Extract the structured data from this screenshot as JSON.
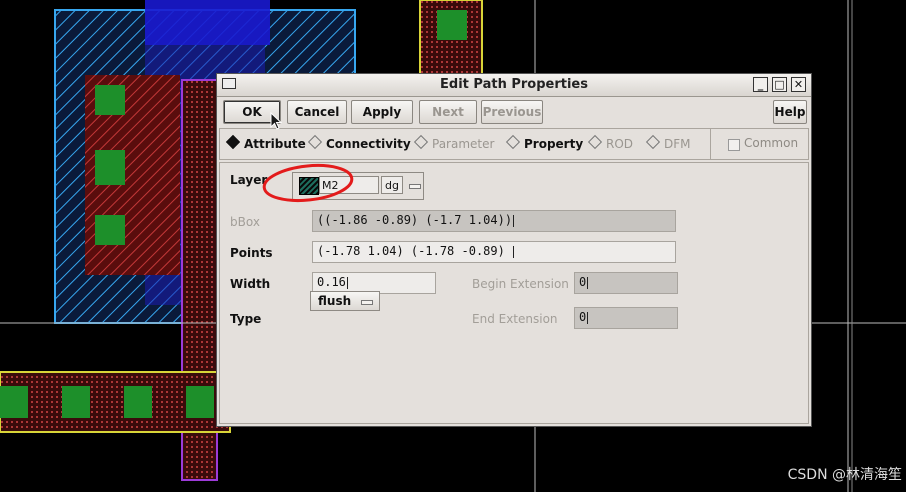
{
  "dialog": {
    "title": "Edit Path Properties",
    "window_buttons": {
      "minimize": "_",
      "maximize": "□",
      "close": "✕"
    },
    "toolbar": {
      "ok": "OK",
      "cancel": "Cancel",
      "apply": "Apply",
      "next": "Next",
      "previous": "Previous",
      "help": "Help"
    },
    "tabs": [
      {
        "label": "Attribute",
        "selected": true,
        "enabled": true
      },
      {
        "label": "Connectivity",
        "selected": false,
        "enabled": true
      },
      {
        "label": "Parameter",
        "selected": false,
        "enabled": false
      },
      {
        "label": "Property",
        "selected": false,
        "enabled": true
      },
      {
        "label": "ROD",
        "selected": false,
        "enabled": false
      },
      {
        "label": "DFM",
        "selected": false,
        "enabled": false
      }
    ],
    "common_label": "Common",
    "fields": {
      "layer_label": "Layer",
      "layer_name": "M2",
      "layer_purpose": "dg",
      "bbox_label": "bBox",
      "bbox_value": "((-1.86 -0.89) (-1.7 1.04))",
      "points_label": "Points",
      "points_value": "(-1.78 1.04) (-1.78 -0.89)",
      "width_label": "Width",
      "width_value": "0.16",
      "type_label": "Type",
      "type_value": "flush",
      "begin_ext_label": "Begin Extension",
      "begin_ext_value": "0",
      "end_ext_label": "End Extension",
      "end_ext_value": "0"
    }
  },
  "watermark": "CSDN @林清海笙",
  "colors": {
    "annotation_circle": "#e31b1b",
    "layout_bg": "#000000"
  }
}
